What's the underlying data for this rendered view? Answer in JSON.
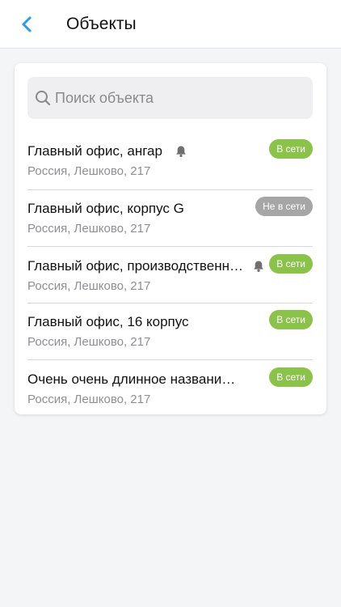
{
  "header": {
    "title": "Объекты",
    "back_icon": "chevron-left-icon",
    "accent_color": "#2b9be8"
  },
  "search": {
    "placeholder": "Поиск объекта",
    "value": "",
    "icon": "search-icon"
  },
  "objects": [
    {
      "name": "Главный офис, ангар",
      "address": "Россия, Лешково, 217",
      "status": "В сети",
      "online": true,
      "bell": true
    },
    {
      "name": "Главный офис, корпус G",
      "address": "Россия, Лешково, 217",
      "status": "Не в сети",
      "online": false,
      "bell": false
    },
    {
      "name": "Главный офис, производственн…",
      "address": "Россия, Лешково, 217",
      "status": "В сети",
      "online": true,
      "bell": true
    },
    {
      "name": "Главный офис, 16 корпус",
      "address": "Россия, Лешково, 217",
      "status": "В сети",
      "online": true,
      "bell": false
    },
    {
      "name": "Очень очень длинное названи…",
      "address": "Россия, Лешково, 217",
      "status": "В сети",
      "online": true,
      "bell": false
    }
  ],
  "colors": {
    "online": "#8bc34a",
    "offline": "#a6a6a6",
    "background": "#f4f5f7"
  }
}
